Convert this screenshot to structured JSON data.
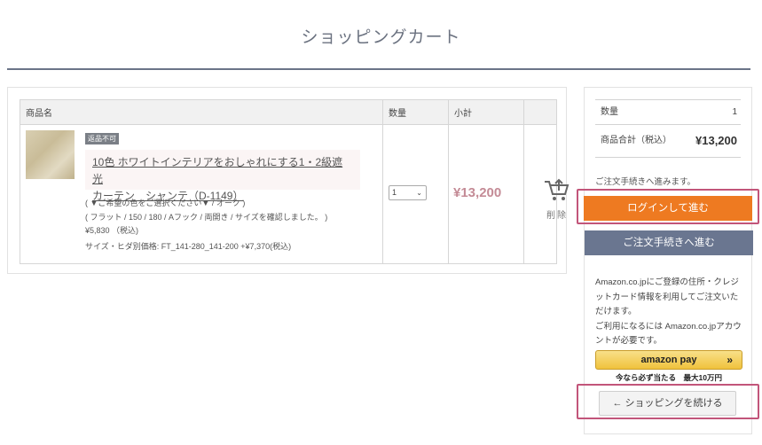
{
  "page": {
    "title": "ショッピングカート"
  },
  "cart": {
    "headers": {
      "name": "商品名",
      "qty": "数量",
      "subtotal": "小計"
    },
    "item": {
      "badge": "返品不可",
      "name_line1": "10色 ホワイトインテリアをおしゃれにする1・2級遮光",
      "name_line2": "カーテン　シャンテ（D-1149）",
      "option1": "( ▼ご希望の色をご選択ください▼ / オーク )",
      "option2": "( フラット / 150 / 180 / Aフック / 両開き / サイズを確認しました。 )",
      "price": "¥5,830 （税込)",
      "extra": "サイズ・ヒダ別価格: FT_141-280_141-200 +¥7,370(税込)",
      "qty": "1",
      "subtotal": "¥13,200",
      "delete_label": "削除",
      "thumb_color": "#d3c7a6"
    }
  },
  "summary": {
    "qty_label": "数量",
    "qty_value": "1",
    "total_label": "商品合計（税込）",
    "total_value": "¥13,200",
    "note": "ご注文手続きへ進みます。",
    "login_button": "ログインして進む",
    "order_button": "ご注文手続きへ進む",
    "amazon_text": "Amazon.co.jpにご登録の住所・クレジットカード情報を利用してご注文いただけます。",
    "amazon_text2": "ご利用になるには Amazon.co.jpアカウントが必要です。",
    "amazon_pay_label": "amazon pay",
    "amazon_pay_arrow": "»",
    "amazon_caption": "今なら必ず当たる　最大10万円",
    "continue_button": "ショッピングを続ける",
    "continue_arrow": "←"
  },
  "colors": {
    "login": "#ee7a21",
    "order": "#6a7690",
    "highlight": "#c2557a",
    "price": "#c48b96"
  }
}
